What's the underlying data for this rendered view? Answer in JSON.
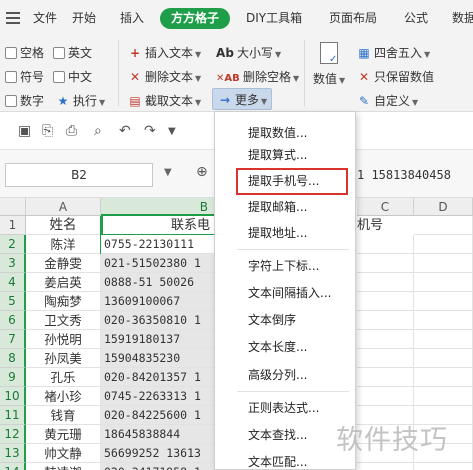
{
  "menubar": {
    "file": "文件",
    "tabs": [
      "开始",
      "插入",
      "方方格子",
      "DIY工具箱",
      "页面布局",
      "公式",
      "数据"
    ],
    "active_tab": "方方格子"
  },
  "ribbon": {
    "checks": [
      "空格",
      "英文",
      "符号",
      "中文",
      "数字"
    ],
    "exec": "执行",
    "insert_text": "插入文本",
    "delete_text": "删除文本",
    "cut_text": "截取文本",
    "case": "大小写",
    "delete_space": "删除空格",
    "more": "更多",
    "numeric": "数值",
    "round": "四舍五入",
    "keep_value": "只保留数值",
    "custom": "自定义"
  },
  "formula": {
    "cell_ref": "B2",
    "value": "1 15813840458"
  },
  "sheet": {
    "columns": [
      "A",
      "B",
      "C",
      "D"
    ],
    "header_row": {
      "name": "姓名",
      "phone": "联系电",
      "c": "机号"
    },
    "rows": [
      {
        "n": "1"
      },
      {
        "n": "2",
        "name": "陈洋",
        "phone": "0755-22130111"
      },
      {
        "n": "3",
        "name": "金静雯",
        "phone": "021-51502380 1"
      },
      {
        "n": "4",
        "name": "姜启英",
        "phone": "0888-51 50026"
      },
      {
        "n": "5",
        "name": "陶痴梦",
        "phone": "13609100067"
      },
      {
        "n": "6",
        "name": "卫文秀",
        "phone": "020-36350810 1"
      },
      {
        "n": "7",
        "name": "孙悦明",
        "phone": "15919180137"
      },
      {
        "n": "8",
        "name": "孙凤美",
        "phone": "15904835230"
      },
      {
        "n": "9",
        "name": "孔乐",
        "phone": "020-84201357 1"
      },
      {
        "n": "10",
        "name": "褚小珍",
        "phone": "0745-2263313 1"
      },
      {
        "n": "11",
        "name": "钱育",
        "phone": "020-84225600 1"
      },
      {
        "n": "12",
        "name": "黄元珊",
        "phone": "18645838844"
      },
      {
        "n": "13",
        "name": "帅文静",
        "phone": "56699252 13613"
      },
      {
        "n": "14",
        "name": "韩凌迦",
        "phone": "020-34171958 1"
      }
    ]
  },
  "dropdown": {
    "items": [
      "提取数值...",
      "提取算式...",
      "提取手机号...",
      "提取邮箱...",
      "提取地址...",
      "字符上下标...",
      "文本间隔插入...",
      "文本倒序",
      "文本长度...",
      "高级分列...",
      "正则表达式...",
      "文本查找...",
      "文本匹配..."
    ],
    "highlighted": "提取手机号..."
  },
  "watermark": "软件技巧"
}
